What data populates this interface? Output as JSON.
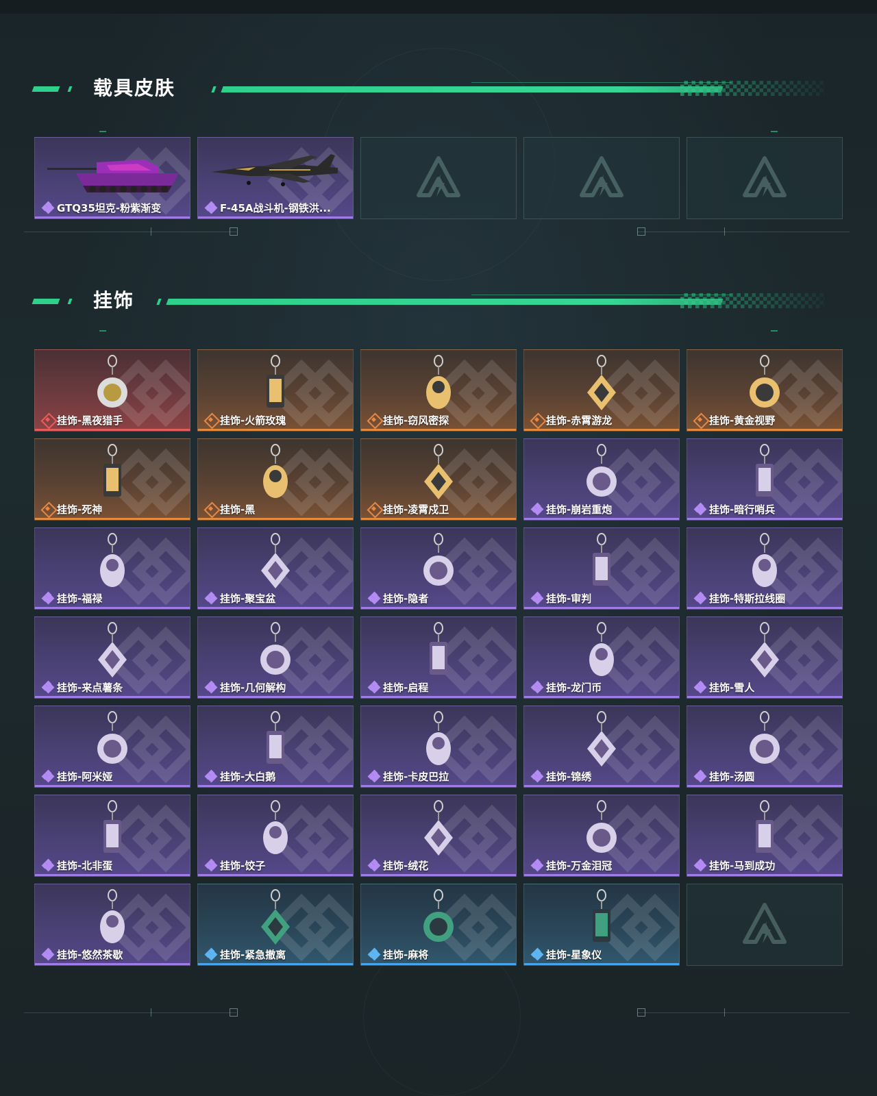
{
  "sections": {
    "vehicle": {
      "title": "载具皮肤"
    },
    "charm": {
      "title": "挂饰"
    }
  },
  "vehicle_items": [
    {
      "name": "GTQ35坦克-粉紫渐变",
      "rarity": "purple",
      "icon": "pink-purple-tank-icon"
    },
    {
      "name": "F-45A战斗机-钢铁洪...",
      "rarity": "purple",
      "icon": "black-gold-fighter-jet-icon"
    },
    {
      "name": "",
      "rarity": "empty",
      "icon": "empty-slot-logo-icon"
    },
    {
      "name": "",
      "rarity": "empty",
      "icon": "empty-slot-logo-icon"
    },
    {
      "name": "",
      "rarity": "empty",
      "icon": "empty-slot-logo-icon"
    }
  ],
  "charm_items": [
    {
      "name": "挂饰-黑夜猎手",
      "rarity": "red",
      "icon": "night-hunter-charm-icon"
    },
    {
      "name": "挂饰-火箭玫瑰",
      "rarity": "orange",
      "icon": "rocket-rose-charm-icon"
    },
    {
      "name": "挂饰-窃风密探",
      "rarity": "orange",
      "icon": "wind-spy-charm-icon"
    },
    {
      "name": "挂饰-赤霄游龙",
      "rarity": "orange",
      "icon": "crimson-dragon-charm-icon"
    },
    {
      "name": "挂饰-黄金视野",
      "rarity": "orange",
      "icon": "golden-vision-charm-icon"
    },
    {
      "name": "挂饰-死神",
      "rarity": "orange",
      "icon": "reaper-card-charm-icon"
    },
    {
      "name": "挂饰-黑",
      "rarity": "orange",
      "icon": "black-tag-charm-icon"
    },
    {
      "name": "挂饰-凌霄戍卫",
      "rarity": "orange",
      "icon": "sky-guard-charm-icon"
    },
    {
      "name": "挂饰-崩岩重炮",
      "rarity": "purple",
      "icon": "rock-cannon-charm-icon"
    },
    {
      "name": "挂饰-暗行哨兵",
      "rarity": "purple",
      "icon": "shadow-sentry-charm-icon"
    },
    {
      "name": "挂饰-福禄",
      "rarity": "purple",
      "icon": "gourd-charm-icon"
    },
    {
      "name": "挂饰-聚宝盆",
      "rarity": "purple",
      "icon": "treasure-bowl-charm-icon"
    },
    {
      "name": "挂饰-隐者",
      "rarity": "purple",
      "icon": "hermit-card-charm-icon"
    },
    {
      "name": "挂饰-审判",
      "rarity": "purple",
      "icon": "judgement-card-charm-icon"
    },
    {
      "name": "挂饰-特斯拉线圈",
      "rarity": "purple",
      "icon": "tesla-coil-charm-icon"
    },
    {
      "name": "挂饰-来点薯条",
      "rarity": "purple",
      "icon": "fries-charm-icon"
    },
    {
      "name": "挂饰-几何解构",
      "rarity": "purple",
      "icon": "geometric-helmet-charm-icon"
    },
    {
      "name": "挂饰-启程",
      "rarity": "purple",
      "icon": "departure-medal-charm-icon"
    },
    {
      "name": "挂饰-龙门币",
      "rarity": "purple",
      "icon": "coin-card-charm-icon"
    },
    {
      "name": "挂饰-雪人",
      "rarity": "purple",
      "icon": "snowman-charm-icon"
    },
    {
      "name": "挂饰-阿米娅",
      "rarity": "purple",
      "icon": "amiya-charm-icon"
    },
    {
      "name": "挂饰-大白鹅",
      "rarity": "purple",
      "icon": "white-goose-charm-icon"
    },
    {
      "name": "挂饰-卡皮巴拉",
      "rarity": "purple",
      "icon": "capybara-charm-icon"
    },
    {
      "name": "挂饰-锦绣",
      "rarity": "purple",
      "icon": "butterfly-charm-icon"
    },
    {
      "name": "挂饰-汤圆",
      "rarity": "purple",
      "icon": "tangyuan-bowl-charm-icon"
    },
    {
      "name": "挂饰-北非蛋",
      "rarity": "purple",
      "icon": "shakshuka-charm-icon"
    },
    {
      "name": "挂饰-饺子",
      "rarity": "purple",
      "icon": "dumpling-plate-charm-icon"
    },
    {
      "name": "挂饰-绒花",
      "rarity": "purple",
      "icon": "velvet-rose-charm-icon"
    },
    {
      "name": "挂饰-万金泪冠",
      "rarity": "purple",
      "icon": "tear-crown-charm-icon"
    },
    {
      "name": "挂饰-马到成功",
      "rarity": "purple",
      "icon": "red-horse-charm-icon"
    },
    {
      "name": "挂饰-悠然茶歇",
      "rarity": "purple",
      "icon": "cupcake-charm-icon"
    },
    {
      "name": "挂饰-紧急撤离",
      "rarity": "blue",
      "icon": "emergency-exit-charm-icon"
    },
    {
      "name": "挂饰-麻将",
      "rarity": "blue",
      "icon": "mahjong-tile-charm-icon"
    },
    {
      "name": "挂饰-星象仪",
      "rarity": "blue",
      "icon": "astrolabe-charm-icon"
    },
    {
      "name": "",
      "rarity": "empty",
      "icon": "empty-slot-logo-icon"
    }
  ],
  "colors": {
    "accent": "#2fd08c",
    "purple": "#a07ce8",
    "orange": "#e38a3e",
    "red": "#e65b5b",
    "blue": "#4aa3e8"
  }
}
